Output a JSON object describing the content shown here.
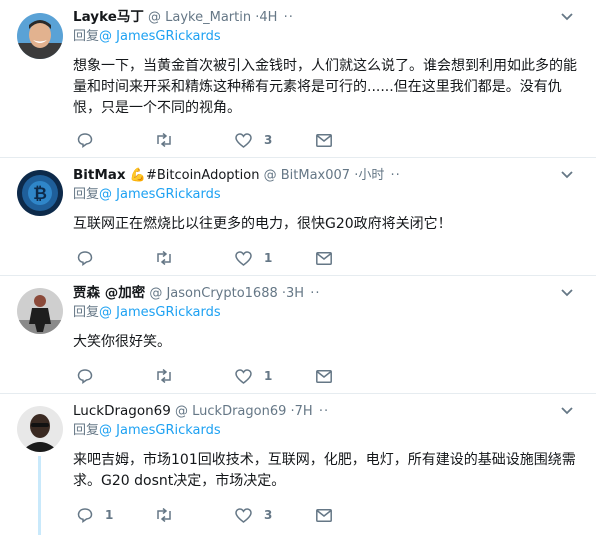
{
  "tweets": [
    {
      "name": "Layke马丁",
      "emoji": "",
      "hashtag": "",
      "handle": "@ Layke_Martin",
      "time": "·4H",
      "dots": "··",
      "reply_prefix": "回复",
      "reply_to": "@ JamesGRickards",
      "text": "想象一下，当黄金首次被引入金钱时，人们就这么说了。谁会想到利用如此多的能量和时间来开采和精炼这种稀有元素将是可行的......但在这里我们都是。没有仇恨，只是一个不同的视角。",
      "reply_count": "",
      "retweet_count": "",
      "like_count": "3"
    },
    {
      "name": "BitMax",
      "emoji": "💪",
      "hashtag": "#BitcoinAdoption",
      "handle": "@ BitMax007",
      "time": "·小时",
      "dots": "··",
      "reply_prefix": "回复",
      "reply_to": "@ JamesGRickards",
      "text": "互联网正在燃烧比以往更多的电力，很快G20政府将关闭它！",
      "reply_count": "",
      "retweet_count": "",
      "like_count": "1"
    },
    {
      "name": "贾森 @加密",
      "emoji": "",
      "hashtag": "",
      "handle": "@ JasonCrypto1688",
      "time": "·3H",
      "dots": "··",
      "reply_prefix": "回复",
      "reply_to": "@ JamesGRickards",
      "text": "大笑你很好笑。",
      "reply_count": "",
      "retweet_count": "",
      "like_count": "1"
    },
    {
      "name": "LuckDragon69",
      "emoji": "",
      "hashtag": "",
      "handle": "@ LuckDragon69",
      "time": "·7H",
      "dots": "··",
      "reply_prefix": "回复",
      "reply_to": "@ JamesGRickards",
      "text": "来吧吉姆，市场101回收技术，互联网，化肥，电灯，所有建设的基础设施围绕需求。G20 dosnt决定，市场决定。",
      "reply_count": "1",
      "retweet_count": "",
      "like_count": "3"
    }
  ],
  "colors": {
    "link": "#1da1f2",
    "muted": "#657786",
    "divider": "#e6ecf0",
    "thread": "#c9e9fb"
  }
}
